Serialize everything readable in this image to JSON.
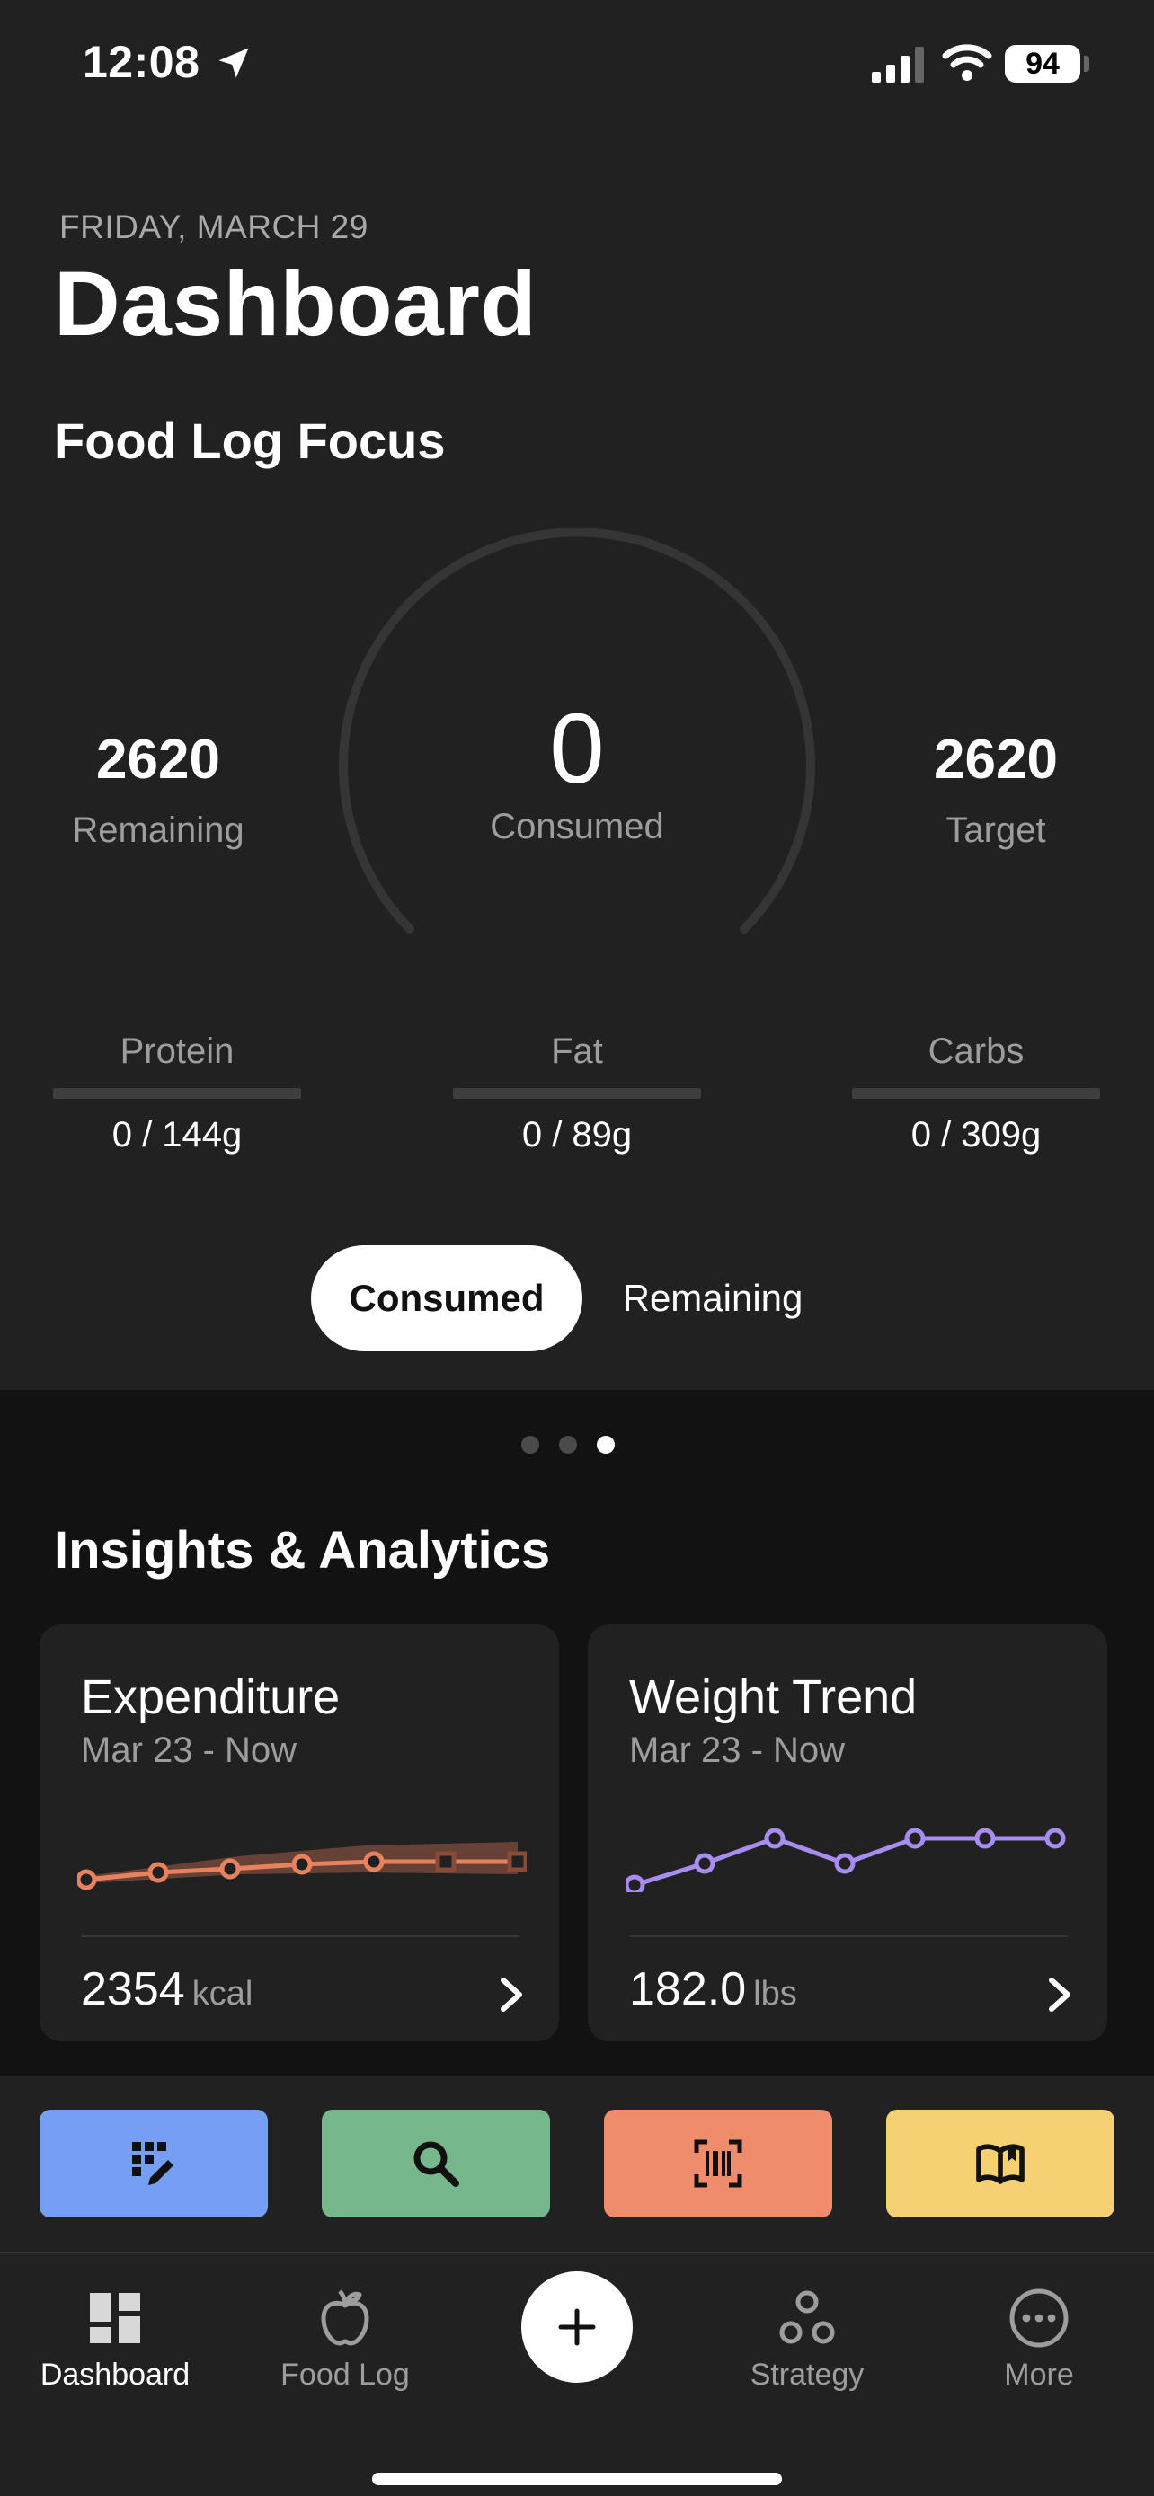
{
  "status_bar": {
    "time": "12:08",
    "battery": "94"
  },
  "header": {
    "date": "FRIDAY, MARCH 29",
    "title": "Dashboard"
  },
  "food_log_focus": {
    "section_title": "Food Log Focus",
    "remaining_value": "2620",
    "remaining_label": "Remaining",
    "consumed_value": "0",
    "consumed_label": "Consumed",
    "target_value": "2620",
    "target_label": "Target",
    "macros": [
      {
        "label": "Protein",
        "value": "0 / 144g",
        "progress": 0
      },
      {
        "label": "Fat",
        "value": "0 / 89g",
        "progress": 0
      },
      {
        "label": "Carbs",
        "value": "0 / 309g",
        "progress": 0
      }
    ],
    "toggle": {
      "active": "Consumed",
      "inactive": "Remaining"
    },
    "page_dots": {
      "count": 3,
      "active_index": 2
    }
  },
  "insights": {
    "title": "Insights & Analytics",
    "cards": [
      {
        "title": "Expenditure",
        "subtitle": "Mar 23 - Now",
        "value": "2354",
        "unit": "kcal",
        "color": "#E8825E"
      },
      {
        "title": "Weight Trend",
        "subtitle": "Mar 23 - Now",
        "value": "182.0",
        "unit": "lbs",
        "color": "#A98CF0"
      }
    ]
  },
  "quick_actions": [
    {
      "icon": "quick-add-grid-icon",
      "color": "#769EF2"
    },
    {
      "icon": "search-icon",
      "color": "#76B88C"
    },
    {
      "icon": "barcode-scan-icon",
      "color": "#EE8C6C"
    },
    {
      "icon": "recipe-book-icon",
      "color": "#F5D174"
    }
  ],
  "tab_bar": {
    "tabs": [
      {
        "label": "Dashboard",
        "icon": "dashboard-icon"
      },
      {
        "label": "Food Log",
        "icon": "apple-icon"
      },
      {
        "label": "Strategy",
        "icon": "strategy-icon"
      },
      {
        "label": "More",
        "icon": "more-icon"
      }
    ],
    "active_tab": "Dashboard"
  }
}
